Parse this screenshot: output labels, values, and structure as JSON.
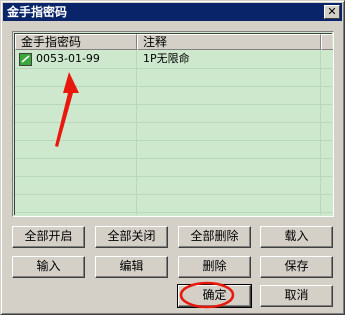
{
  "window": {
    "title": "金手指密码",
    "close_glyph": "✕"
  },
  "list": {
    "columns": [
      "金手指密码",
      "注释"
    ],
    "rows": [
      {
        "code": "0053-01-99",
        "note": "1P无限命",
        "checked": true
      }
    ]
  },
  "buttons": {
    "enable_all": "全部开启",
    "disable_all": "全部关闭",
    "delete_all": "全部删除",
    "load": "载入",
    "input": "输入",
    "edit": "编辑",
    "delete": "删除",
    "save": "保存",
    "ok": "确定",
    "cancel": "取消"
  },
  "colors": {
    "titlebar": "#0a246a",
    "list_background": "#cde8cd",
    "annotation": "#e8180c"
  },
  "icons": {
    "checkbox": "checkmark-icon",
    "close": "close-icon"
  }
}
